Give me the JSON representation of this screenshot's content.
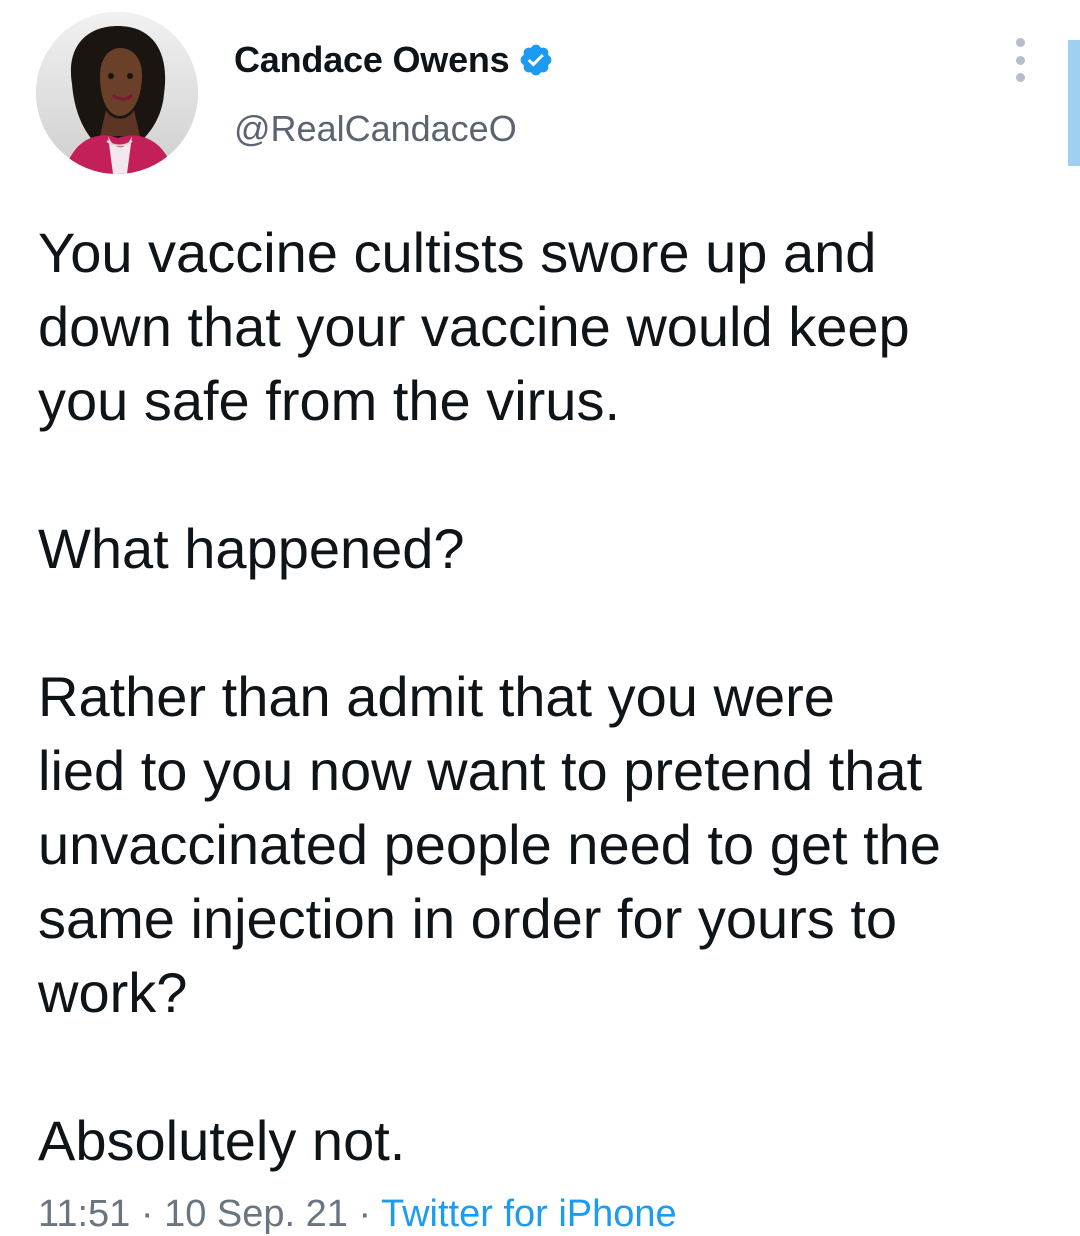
{
  "author": {
    "display_name": "Candace Owens",
    "handle": "@RealCandaceO",
    "verified": true
  },
  "tweet": {
    "paragraph_1": "You vaccine cultists swore up and\ndown that your vaccine would keep\nyou safe from the virus.",
    "paragraph_2": "What happened?",
    "paragraph_3": "Rather than admit that you were\nlied to you now want to pretend that\nunvaccinated people need to get the\nsame injection in order for yours to\nwork?",
    "paragraph_4": "Absolutely not."
  },
  "meta": {
    "time": "11:51",
    "separator": "·",
    "date": "10 Sep. 21",
    "source": "Twitter for iPhone"
  },
  "colors": {
    "accent": "#1d9bf0",
    "text_primary": "#0f1419",
    "text_secondary": "#697580",
    "scroll_indicator": "#9fd0f2"
  },
  "icons": {
    "verified": "verified-badge-icon",
    "more": "more-options-icon"
  }
}
